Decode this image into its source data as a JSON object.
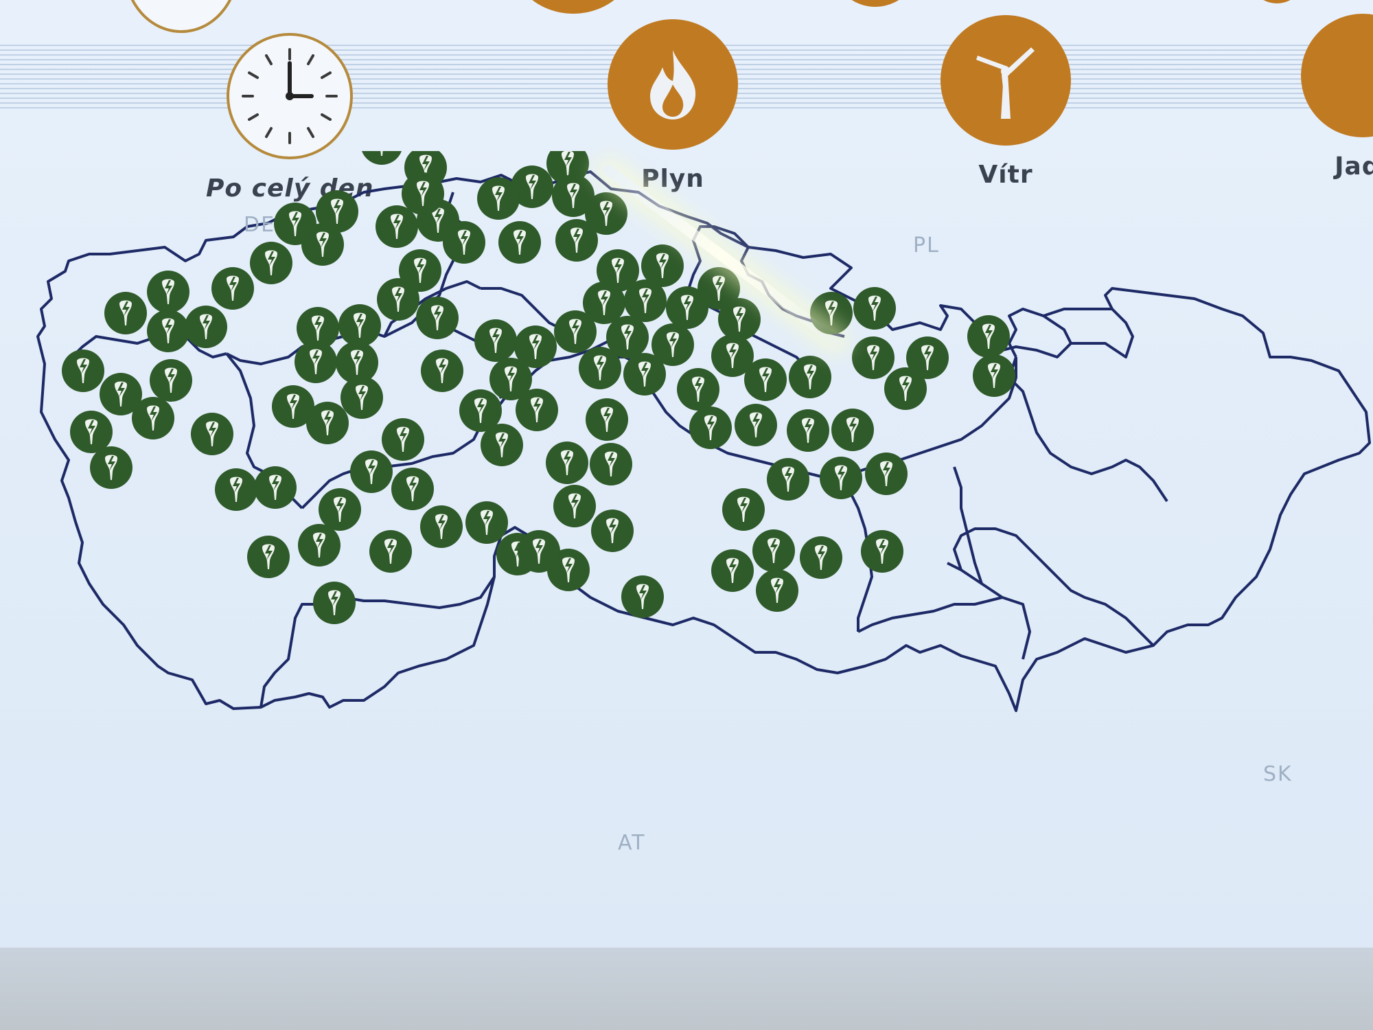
{
  "colors": {
    "accent": "#c07a22",
    "marker": "#2f5a2a",
    "border": "#1e2a66",
    "screen": "#dde9f6"
  },
  "toolbar": {
    "time_filter": {
      "label": "Po celý den",
      "icon": "clock-icon"
    },
    "sources": [
      {
        "label": "Plyn",
        "icon": "flame-icon"
      },
      {
        "label": "Vítr",
        "icon": "wind-turbine-icon"
      },
      {
        "label": "Jade",
        "icon": "nuclear-icon"
      }
    ]
  },
  "map": {
    "neighbours": [
      "DE",
      "PL",
      "AT",
      "SK"
    ],
    "marker_icon": "power-plant-icon"
  }
}
